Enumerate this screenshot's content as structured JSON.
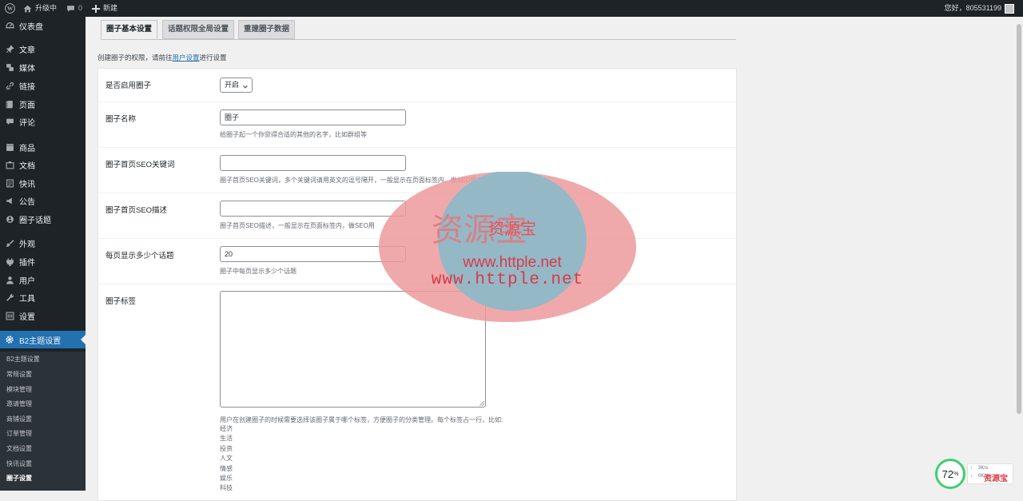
{
  "admin_bar": {
    "site_name": "升级中",
    "comments_count": "0",
    "new_label": "新建",
    "howdy": "您好，805531199"
  },
  "menu": {
    "items": [
      {
        "label": "仪表盘",
        "icon": "dashboard-icon"
      },
      {
        "label": "文章",
        "icon": "pin-icon"
      },
      {
        "label": "媒体",
        "icon": "media-icon"
      },
      {
        "label": "链接",
        "icon": "link-icon"
      },
      {
        "label": "页面",
        "icon": "page-icon"
      },
      {
        "label": "评论",
        "icon": "comment-icon"
      },
      {
        "label": "商品",
        "icon": "store-icon"
      },
      {
        "label": "文档",
        "icon": "doc-icon"
      },
      {
        "label": "快讯",
        "icon": "news-icon"
      },
      {
        "label": "公告",
        "icon": "megaphone-icon"
      },
      {
        "label": "圈子话题",
        "icon": "circle-topic-icon"
      },
      {
        "label": "外观",
        "icon": "brush-icon"
      },
      {
        "label": "插件",
        "icon": "plugin-icon"
      },
      {
        "label": "用户",
        "icon": "user-icon"
      },
      {
        "label": "工具",
        "icon": "wrench-icon"
      },
      {
        "label": "设置",
        "icon": "settings-icon"
      },
      {
        "label": "B2主题设置",
        "icon": "gear-icon"
      }
    ],
    "submenu": [
      "B2主题设置",
      "常规设置",
      "模块管理",
      "邀请管理",
      "商铺设置",
      "订单管理",
      "文档设置",
      "快讯设置",
      "圈子设置"
    ]
  },
  "tabs": [
    "圈子基本设置",
    "话题权限全局设置",
    "重建圈子数据"
  ],
  "intro": {
    "prefix": "创建圈子的权限，请前往",
    "link": "用户设置",
    "suffix": "进行设置"
  },
  "fields": {
    "enable": {
      "label": "是否启用圈子",
      "value": "开启"
    },
    "name": {
      "label": "圈子名称",
      "value": "圈子",
      "desc": "给圈子起一个你觉得合适的其他的名字，比如群组等"
    },
    "seo_keywords": {
      "label": "圈子首页SEO关键词",
      "value": "",
      "desc": "圈子首页SEO关键词，多个关键词请用英文的逗号隔开，一般显示在页面标签内，做SEO用"
    },
    "seo_desc": {
      "label": "圈子首页SEO描述",
      "value": "",
      "desc": "圈子首页SEO描述，一般显示在页面标签内，做SEO用"
    },
    "per_page": {
      "label": "每页显示多少个话题",
      "value": "20",
      "desc": "圈子中每页显示多少个话题"
    },
    "tags": {
      "label": "圈子标签",
      "desc": "用户在创建圈子的时候需要选择该圈子属于哪个标签，方便圈子的分类管理。每个标签占一行，比如:",
      "examples": [
        "经济",
        "生活",
        "投资",
        "人文",
        "情感",
        "娱乐",
        "科技"
      ]
    }
  },
  "watermark": {
    "big_text": "资源宝",
    "inner_text": "资源宝",
    "url1": "www.httple.net",
    "url2": "www.httple.net"
  },
  "speed_widget": {
    "value": "72",
    "unit": "%"
  },
  "net_widget": {
    "up": "3K/s",
    "down": "0K/s",
    "logo": "资源宝"
  }
}
